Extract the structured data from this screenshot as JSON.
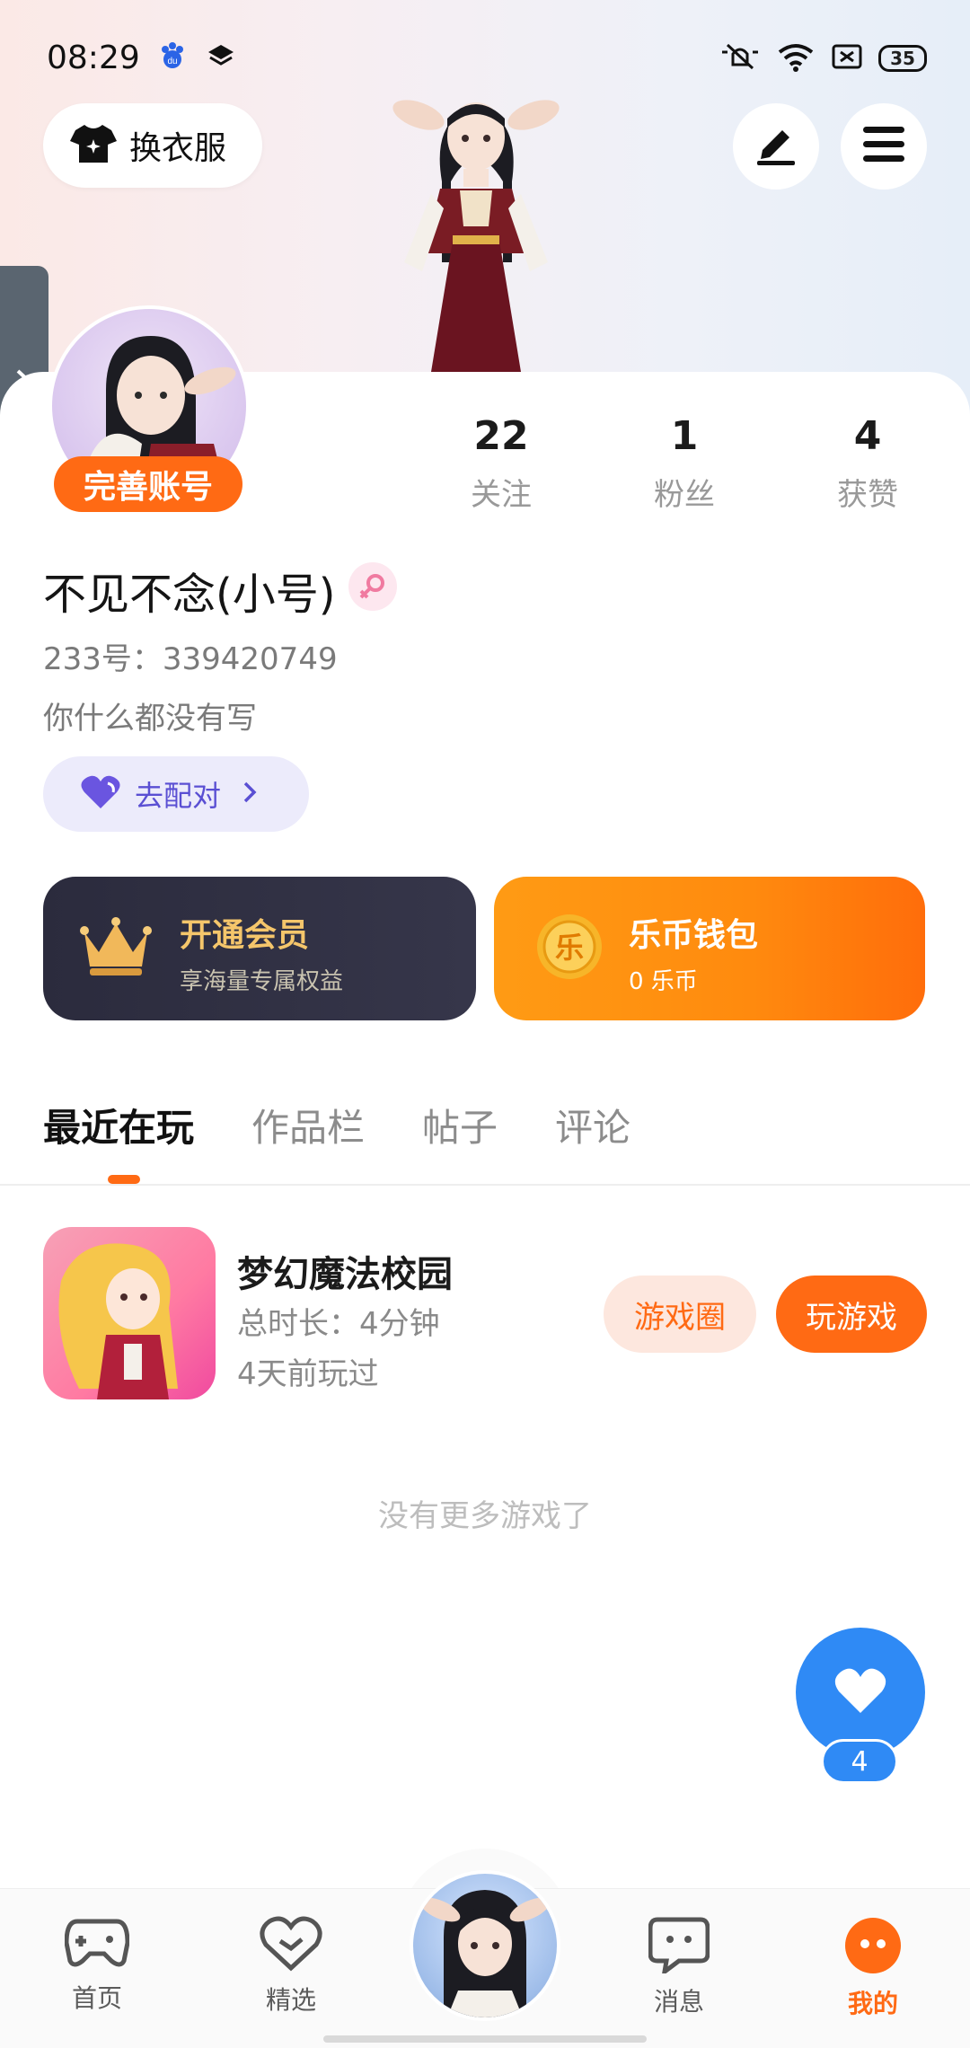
{
  "status_bar": {
    "time": "08:29",
    "battery": "35",
    "icons": [
      "baidu-icon",
      "layers-icon",
      "mute-icon",
      "wifi-icon",
      "sim-icon",
      "battery-icon"
    ]
  },
  "header": {
    "change_clothes_label": "换衣服"
  },
  "profile": {
    "complete_account_label": "完善账号",
    "stats": [
      {
        "value": "22",
        "label": "关注"
      },
      {
        "value": "1",
        "label": "粉丝"
      },
      {
        "value": "4",
        "label": "获赞"
      }
    ],
    "username": "不见不念(小号)",
    "uid": "233号：339420749",
    "bio": "你什么都没有写",
    "match_label": "去配对"
  },
  "cards": {
    "vip": {
      "title": "开通会员",
      "subtitle": "享海量专属权益"
    },
    "wallet": {
      "title": "乐币钱包",
      "subtitle": "0 乐币",
      "coin_glyph": "乐"
    }
  },
  "tabs": [
    {
      "label": "最近在玩",
      "active": true
    },
    {
      "label": "作品栏",
      "active": false
    },
    {
      "label": "帖子",
      "active": false
    },
    {
      "label": "评论",
      "active": false
    }
  ],
  "recent_games": [
    {
      "name": "梦幻魔法校园",
      "duration": "总时长：4分钟",
      "last_played": "4天前玩过",
      "circle_button": "游戏圈",
      "play_button": "玩游戏"
    }
  ],
  "no_more_text": "没有更多游戏了",
  "fab": {
    "count": "4"
  },
  "bottom_nav": [
    {
      "label": "首页",
      "icon": "gamepad-icon",
      "active": false
    },
    {
      "label": "精选",
      "icon": "heart-check-icon",
      "active": false
    },
    {
      "label": "",
      "icon": "avatar",
      "active": false
    },
    {
      "label": "消息",
      "icon": "chat-icon",
      "active": false
    },
    {
      "label": "我的",
      "icon": "profile-icon",
      "active": true
    }
  ],
  "colors": {
    "accent": "#ff6a14",
    "vip_gold": "#f5c66b",
    "fab_blue": "#2f8af5",
    "match_purple": "#5a4fd3"
  }
}
